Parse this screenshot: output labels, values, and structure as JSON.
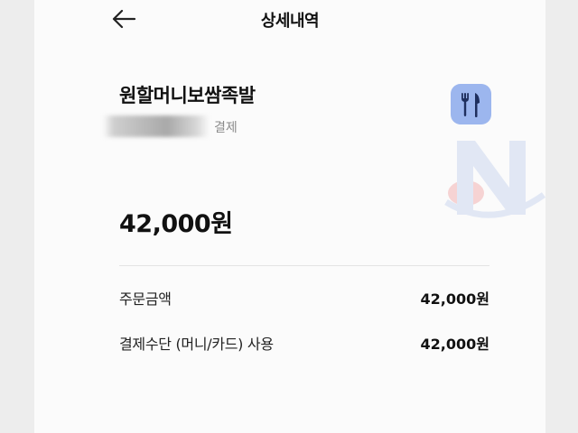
{
  "header": {
    "title": "상세내역",
    "back_icon": "arrow-left-icon"
  },
  "merchant": {
    "name": "원할머니보쌈족발",
    "payment_label": "결제",
    "icon": "fork-knife-icon",
    "icon_color": "#9cb6ee"
  },
  "total": {
    "amount": "42,000원"
  },
  "breakdown": [
    {
      "label": "주문금액",
      "value": "42,000원"
    },
    {
      "label": "결제수단 (머니/카드) 사용",
      "value": "42,000원"
    }
  ]
}
